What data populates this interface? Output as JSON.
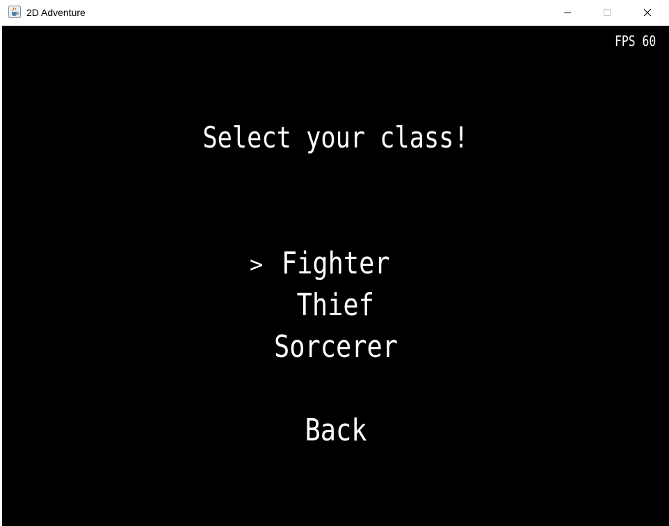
{
  "window": {
    "title": "2D Adventure",
    "icon": "java-cup-icon",
    "controls": [
      "minimize-icon",
      "maximize-icon",
      "close-icon"
    ]
  },
  "hud": {
    "fps_label": "FPS 60"
  },
  "menu": {
    "heading": "Select your class!",
    "cursor": ">",
    "selected_index": 0,
    "options": [
      {
        "label": "Fighter"
      },
      {
        "label": "Thief"
      },
      {
        "label": "Sorcerer"
      }
    ],
    "back_label": "Back"
  },
  "colors": {
    "background": "#000000",
    "text": "#ffffff",
    "titlebar": "#ffffff"
  }
}
